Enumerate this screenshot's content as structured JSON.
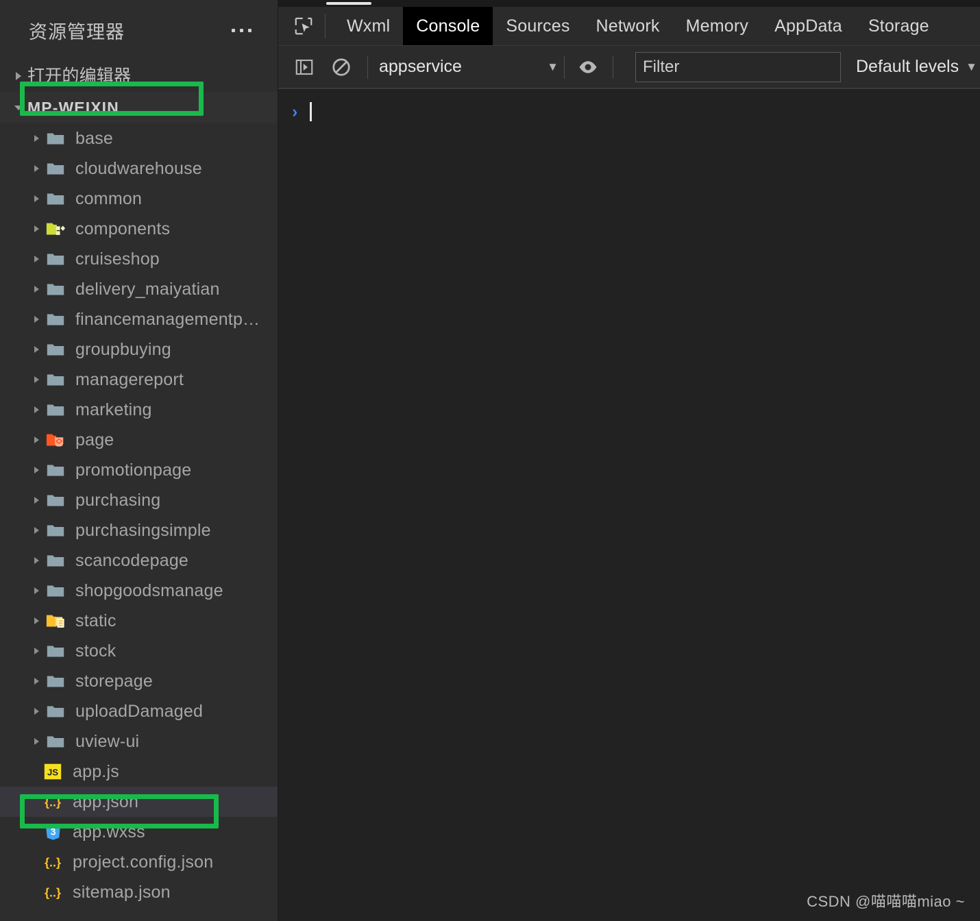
{
  "sidebar": {
    "title": "资源管理器",
    "more_icon": "ellipsis-icon",
    "open_editors_label": "打开的编辑器",
    "root_label": "MP-WEIXIN",
    "items": [
      {
        "label": "base",
        "icon": "folder-blue-icon",
        "type": "folder"
      },
      {
        "label": "cloudwarehouse",
        "icon": "folder-blue-icon",
        "type": "folder"
      },
      {
        "label": "common",
        "icon": "folder-blue-icon",
        "type": "folder"
      },
      {
        "label": "components",
        "icon": "folder-components-icon",
        "type": "folder"
      },
      {
        "label": "cruiseshop",
        "icon": "folder-blue-icon",
        "type": "folder"
      },
      {
        "label": "delivery_maiyatian",
        "icon": "folder-blue-icon",
        "type": "folder"
      },
      {
        "label": "financemanagementp…",
        "icon": "folder-blue-icon",
        "type": "folder"
      },
      {
        "label": "groupbuying",
        "icon": "folder-blue-icon",
        "type": "folder"
      },
      {
        "label": "managereport",
        "icon": "folder-blue-icon",
        "type": "folder"
      },
      {
        "label": "marketing",
        "icon": "folder-blue-icon",
        "type": "folder"
      },
      {
        "label": "page",
        "icon": "folder-views-icon",
        "type": "folder"
      },
      {
        "label": "promotionpage",
        "icon": "folder-blue-icon",
        "type": "folder"
      },
      {
        "label": "purchasing",
        "icon": "folder-blue-icon",
        "type": "folder"
      },
      {
        "label": "purchasingsimple",
        "icon": "folder-blue-icon",
        "type": "folder"
      },
      {
        "label": "scancodepage",
        "icon": "folder-blue-icon",
        "type": "folder"
      },
      {
        "label": "shopgoodsmanage",
        "icon": "folder-blue-icon",
        "type": "folder"
      },
      {
        "label": "static",
        "icon": "folder-resource-icon",
        "type": "folder"
      },
      {
        "label": "stock",
        "icon": "folder-blue-icon",
        "type": "folder"
      },
      {
        "label": "storepage",
        "icon": "folder-blue-icon",
        "type": "folder"
      },
      {
        "label": "uploadDamaged",
        "icon": "folder-blue-icon",
        "type": "folder"
      },
      {
        "label": "uview-ui",
        "icon": "folder-blue-icon",
        "type": "folder"
      },
      {
        "label": "app.js",
        "icon": "js-file-icon",
        "type": "file"
      },
      {
        "label": "app.json",
        "icon": "json-file-icon",
        "type": "file",
        "selected": true
      },
      {
        "label": "app.wxss",
        "icon": "css-file-icon",
        "type": "file"
      },
      {
        "label": "project.config.json",
        "icon": "json-file-icon",
        "type": "file"
      },
      {
        "label": "sitemap.json",
        "icon": "json-file-icon",
        "type": "file"
      }
    ]
  },
  "devtools": {
    "select_element_icon": "inspect-element-icon",
    "tabs": [
      {
        "label": "Wxml",
        "active": false
      },
      {
        "label": "Console",
        "active": true
      },
      {
        "label": "Sources",
        "active": false
      },
      {
        "label": "Network",
        "active": false
      },
      {
        "label": "Memory",
        "active": false
      },
      {
        "label": "AppData",
        "active": false
      },
      {
        "label": "Storage",
        "active": false
      }
    ],
    "toolbar": {
      "sidebar_toggle_icon": "console-sidebar-icon",
      "clear_icon": "clear-console-icon",
      "context_value": "appservice",
      "context_caret": "▼",
      "eye_icon": "live-expression-icon",
      "filter_placeholder": "Filter",
      "filter_value": "",
      "levels_label": "Default levels",
      "levels_caret": "▼"
    },
    "console": {
      "prompt": "›",
      "input_value": ""
    }
  },
  "annotations": {
    "highlight_color": "#19b94b",
    "boxes": [
      "root-label-highlight",
      "app-json-highlight"
    ]
  },
  "watermark": "CSDN @喵喵喵miao ~"
}
